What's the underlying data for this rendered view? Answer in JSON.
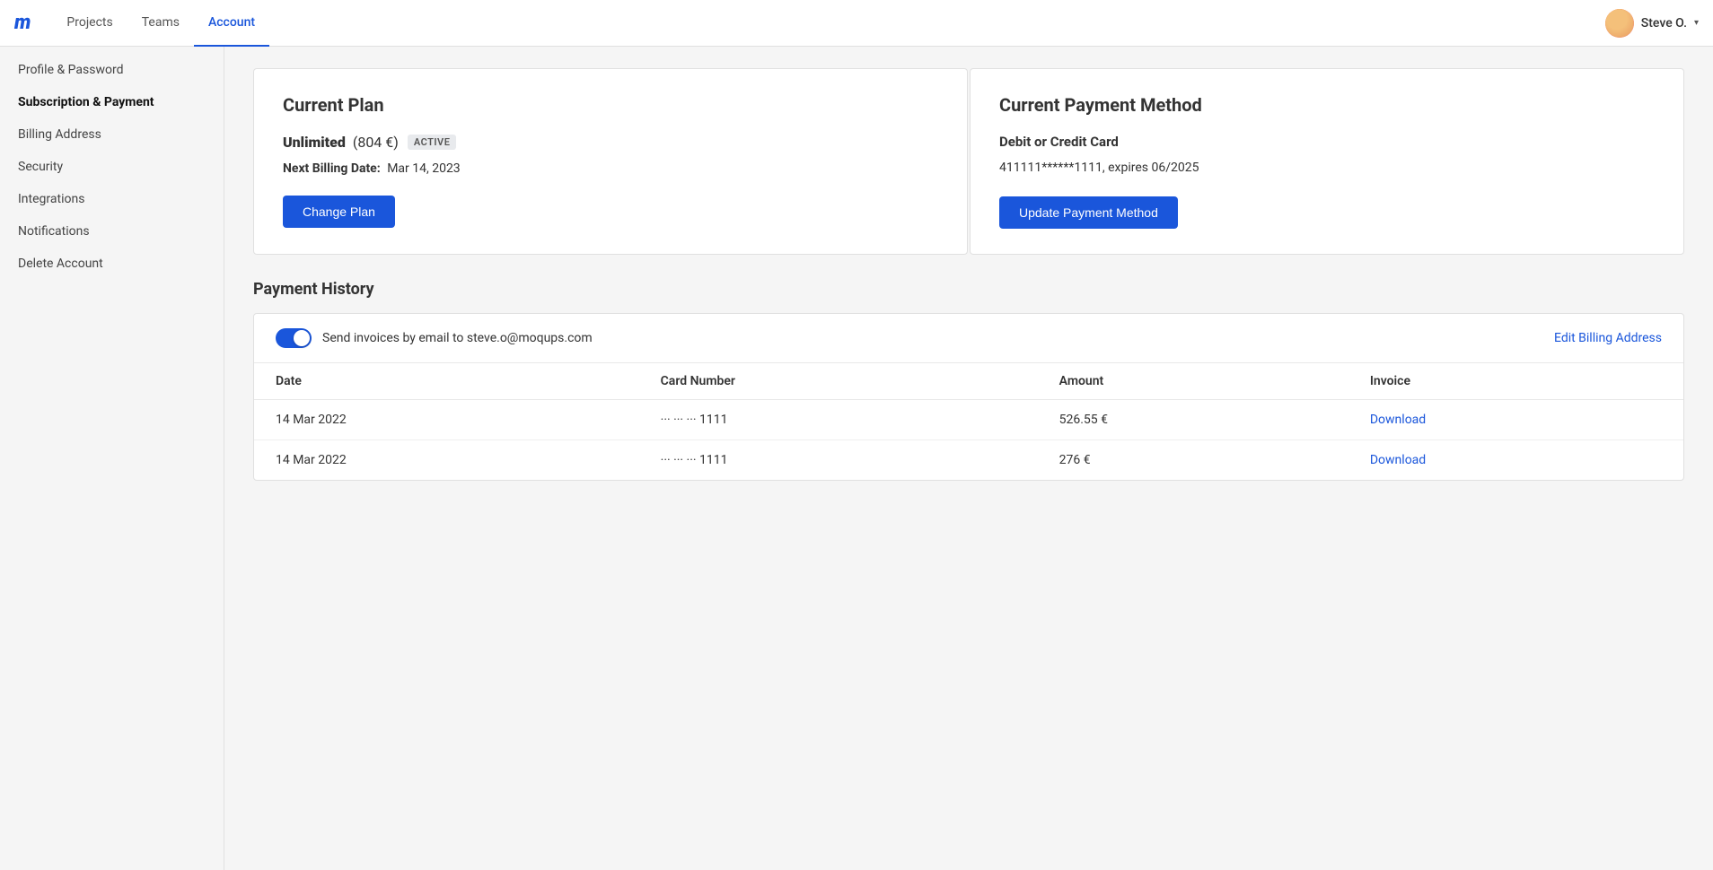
{
  "nav": {
    "logo": "m",
    "links": [
      {
        "label": "Projects",
        "active": false,
        "name": "projects"
      },
      {
        "label": "Teams",
        "active": false,
        "name": "teams"
      },
      {
        "label": "Account",
        "active": true,
        "name": "account"
      }
    ],
    "user": {
      "name": "Steve O.",
      "chevron": "▾"
    }
  },
  "sidebar": {
    "items": [
      {
        "label": "Profile & Password",
        "active": false,
        "name": "profile-password"
      },
      {
        "label": "Subscription & Payment",
        "active": true,
        "name": "subscription-payment"
      },
      {
        "label": "Billing Address",
        "active": false,
        "name": "billing-address"
      },
      {
        "label": "Security",
        "active": false,
        "name": "security"
      },
      {
        "label": "Integrations",
        "active": false,
        "name": "integrations"
      },
      {
        "label": "Notifications",
        "active": false,
        "name": "notifications"
      },
      {
        "label": "Delete Account",
        "active": false,
        "name": "delete-account"
      }
    ]
  },
  "current_plan": {
    "title": "Current Plan",
    "plan_name": "Unlimited",
    "plan_price": "(804 €)",
    "badge": "ACTIVE",
    "next_billing_label": "Next Billing Date:",
    "next_billing_date": "Mar 14, 2023",
    "change_plan_btn": "Change Plan"
  },
  "current_payment": {
    "title": "Current Payment Method",
    "type": "Debit or Credit Card",
    "card_info": "411111******1111, expires 06/2025",
    "update_btn": "Update Payment Method"
  },
  "payment_history": {
    "title": "Payment History",
    "toggle_label": "Send invoices by email to steve.o@moqups.com",
    "edit_billing_link": "Edit Billing Address",
    "table": {
      "columns": [
        "Date",
        "Card Number",
        "Amount",
        "Invoice"
      ],
      "rows": [
        {
          "date": "14 Mar 2022",
          "card": "···  ···  ···  1111",
          "amount": "526.55 €",
          "invoice": "Download"
        },
        {
          "date": "14 Mar 2022",
          "card": "···  ···  ···  1111",
          "amount": "276 €",
          "invoice": "Download"
        }
      ]
    }
  }
}
